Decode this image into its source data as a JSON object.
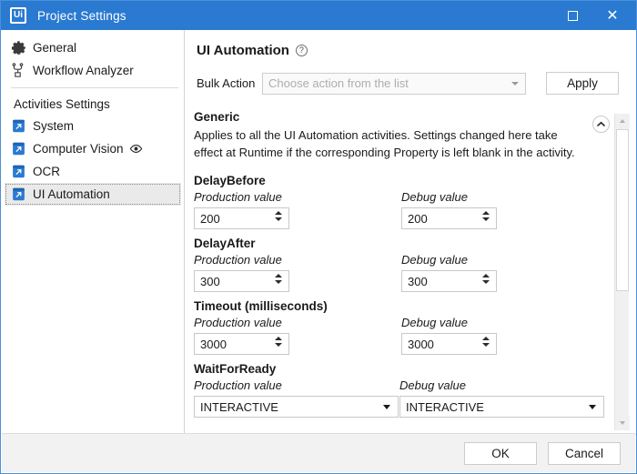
{
  "window": {
    "title": "Project Settings",
    "logo_text": "Ui",
    "maximize_icon": "maximize-icon",
    "close_icon": "close-icon",
    "accent_color": "#2a7ad1"
  },
  "sidebar": {
    "items": [
      {
        "label": "General",
        "icon": "gear-icon",
        "selected": false
      },
      {
        "label": "Workflow Analyzer",
        "icon": "workflow-analyzer-icon",
        "selected": false
      }
    ],
    "group_title": "Activities Settings",
    "activity_items": [
      {
        "label": "System",
        "icon": "activity-icon",
        "selected": false,
        "badge": ""
      },
      {
        "label": "Computer Vision",
        "icon": "activity-icon",
        "selected": false,
        "badge": "eye-icon"
      },
      {
        "label": "OCR",
        "icon": "activity-icon",
        "selected": false,
        "badge": ""
      },
      {
        "label": "UI Automation",
        "icon": "activity-icon",
        "selected": true,
        "badge": ""
      }
    ]
  },
  "main": {
    "page_title": "UI Automation",
    "help_icon": "help-icon",
    "help_glyph": "?",
    "bulk_action": {
      "label": "Bulk Action",
      "placeholder": "Choose action from the list",
      "value": "",
      "apply_label": "Apply"
    },
    "generic": {
      "heading": "Generic",
      "description": "Applies to all the UI Automation activities. Settings changed here take effect at Runtime if the corresponding Property is left blank in the activity.",
      "collapse_icon": "chevron-up-icon"
    },
    "column_labels": {
      "production": "Production value",
      "debug": "Debug value"
    },
    "fields": [
      {
        "title": "DelayBefore",
        "control": "spinner",
        "production_value": "200",
        "debug_value": "200"
      },
      {
        "title": "DelayAfter",
        "control": "spinner",
        "production_value": "300",
        "debug_value": "300"
      },
      {
        "title": "Timeout (milliseconds)",
        "control": "spinner",
        "production_value": "3000",
        "debug_value": "3000"
      },
      {
        "title": "WaitForReady",
        "control": "dropdown",
        "production_value": "INTERACTIVE",
        "debug_value": "INTERACTIVE"
      }
    ]
  },
  "scrollbar": {
    "up_icon": "scroll-up-icon",
    "down_icon": "scroll-down-icon"
  },
  "footer": {
    "ok_label": "OK",
    "cancel_label": "Cancel"
  }
}
